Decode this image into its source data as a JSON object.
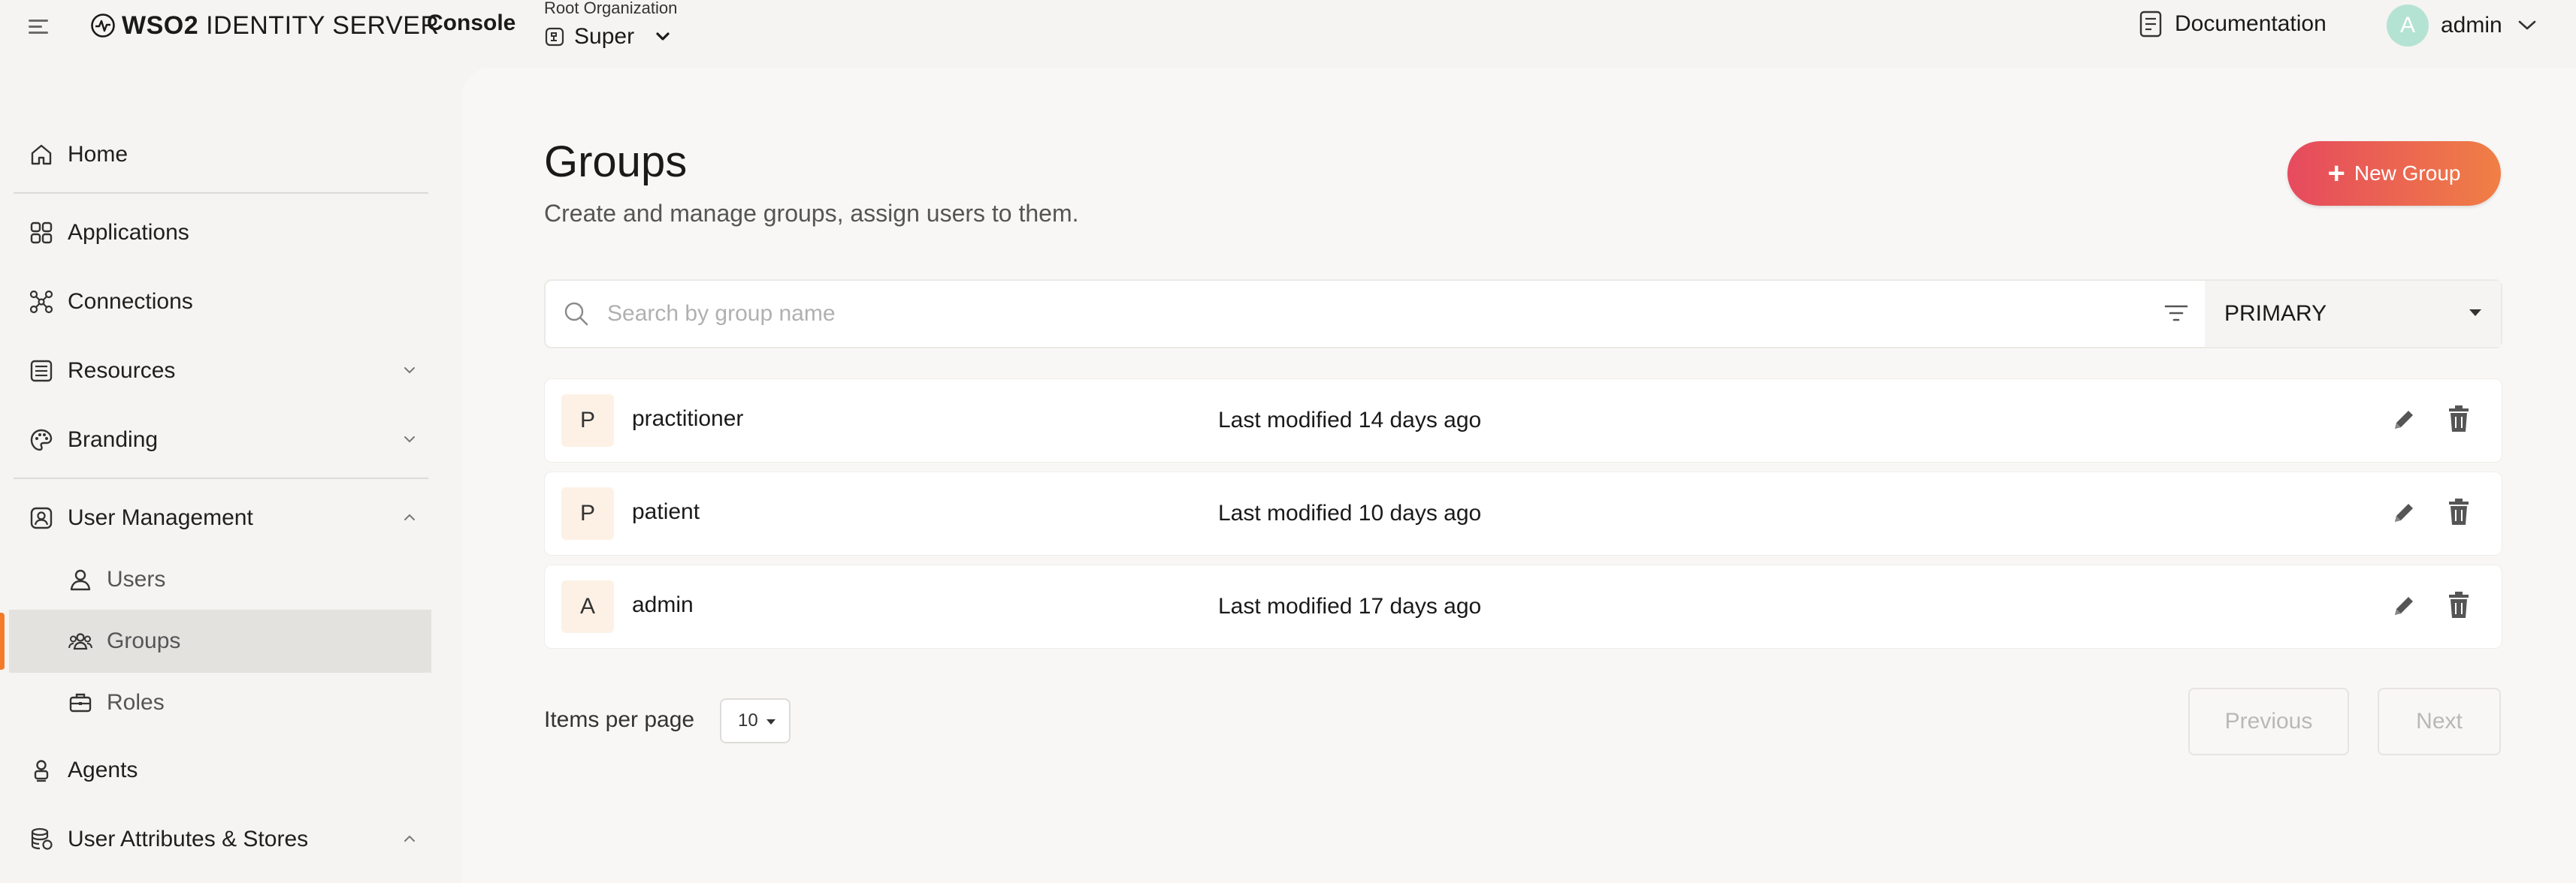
{
  "header": {
    "logo_bold": "WSO2",
    "logo_rest": " IDENTITY SERVER",
    "console_label": "Console",
    "org_label": "Root Organization",
    "org_name": "Super",
    "docs_label": "Documentation",
    "user_initial": "A",
    "user_name": "admin"
  },
  "sidebar": {
    "items": [
      {
        "label": "Home",
        "icon": "home-icon"
      },
      {
        "label": "Applications",
        "icon": "applications-icon"
      },
      {
        "label": "Connections",
        "icon": "connections-icon"
      },
      {
        "label": "Resources",
        "icon": "resources-icon",
        "expanded": false
      },
      {
        "label": "Branding",
        "icon": "branding-icon",
        "expanded": false
      },
      {
        "label": "User Management",
        "icon": "user-management-icon",
        "expanded": true
      },
      {
        "label": "Users",
        "icon": "user-icon"
      },
      {
        "label": "Groups",
        "icon": "groups-icon",
        "active": true
      },
      {
        "label": "Roles",
        "icon": "roles-icon"
      },
      {
        "label": "Agents",
        "icon": "agents-icon"
      },
      {
        "label": "User Attributes & Stores",
        "icon": "user-attributes-icon",
        "expanded": true
      }
    ]
  },
  "page": {
    "title": "Groups",
    "subtitle": "Create and manage groups, assign users to them.",
    "new_button": "New Group"
  },
  "search": {
    "placeholder": "Search by group name",
    "value": "",
    "user_store": "PRIMARY"
  },
  "groups": [
    {
      "initial": "P",
      "name": "practitioner",
      "modified": "Last modified 14 days ago"
    },
    {
      "initial": "P",
      "name": "patient",
      "modified": "Last modified 10 days ago"
    },
    {
      "initial": "A",
      "name": "admin",
      "modified": "Last modified 17 days ago"
    }
  ],
  "pagination": {
    "items_per_page_label": "Items per page",
    "items_per_page": "10",
    "previous": "Previous",
    "next": "Next"
  },
  "colors": {
    "accent_start": "#e64a5e",
    "accent_end": "#f07f45",
    "active_indicator": "#f47b2a",
    "avatar": "#b5e3d3"
  }
}
